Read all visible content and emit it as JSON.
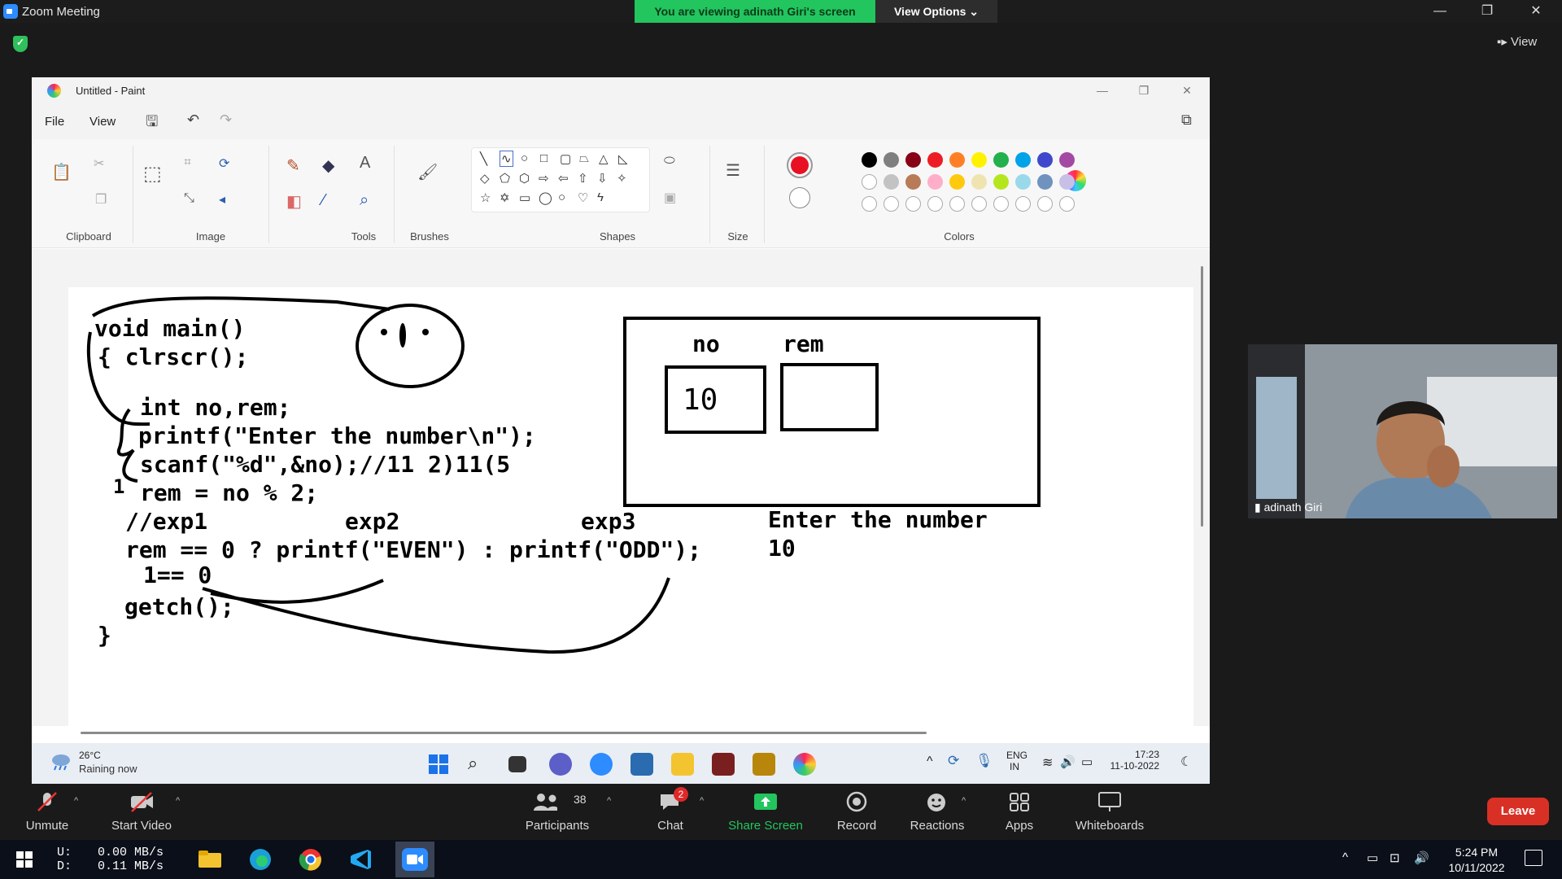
{
  "zoom": {
    "window_title": "Zoom Meeting",
    "banner": "You are viewing adinath Giri's screen",
    "view_options": "View Options ⌄",
    "view_label": "View",
    "controls": {
      "unmute": "Unmute",
      "start_video": "Start Video",
      "participants": "Participants",
      "participants_count": "38",
      "chat": "Chat",
      "chat_badge": "2",
      "share_screen": "Share Screen",
      "record": "Record",
      "reactions": "Reactions",
      "apps": "Apps",
      "whiteboards": "Whiteboards",
      "leave": "Leave"
    },
    "participant_name": "adinath Giri",
    "colors": {
      "share_green": "#23c55e",
      "leave_red": "#d93025"
    }
  },
  "paint": {
    "title": "Untitled - Paint",
    "menu": {
      "file": "File",
      "view": "View"
    },
    "groups": {
      "clipboard": "Clipboard",
      "image": "Image",
      "tools": "Tools",
      "brushes": "Brushes",
      "shapes": "Shapes",
      "size": "Size",
      "colors": "Colors"
    },
    "primary_color": "#e81123",
    "palette_row1": [
      "#000000",
      "#7f7f7f",
      "#880015",
      "#ed1c24",
      "#ff7f27",
      "#fff200",
      "#22b14c",
      "#00a2e8",
      "#3f48cc",
      "#a349a4"
    ],
    "palette_row2": [
      "#ffffff",
      "#c3c3c3",
      "#b97a57",
      "#ffaec9",
      "#ffc90e",
      "#efe4b0",
      "#b5e61d",
      "#99d9ea",
      "#7092be",
      "#c8bfe7"
    ]
  },
  "drawing": {
    "code_lines": [
      "void main()",
      "{ clrscr();",
      "int no,rem;",
      "printf(\"Enter the number\\n\");",
      "scanf(\"%d\",&no);//11 2)11(5",
      "rem = no % 2;",
      "//exp1",
      "exp2",
      "exp3",
      "rem == 0 ? printf(\"EVEN\") : printf(\"ODD\");",
      "1== 0",
      "getch();",
      "}",
      "1"
    ],
    "memory": {
      "var1_label": "no",
      "var2_label": "rem",
      "var1_value": "10",
      "var2_value": ""
    },
    "output_lines": [
      "Enter the number",
      "10"
    ]
  },
  "inner_taskbar": {
    "weather_temp": "26°C",
    "weather_desc": "Raining now",
    "lang1": "ENG",
    "lang2": "IN",
    "time": "17:23",
    "date": "11-10-2022"
  },
  "host_taskbar": {
    "net_labels": "U:\nD:",
    "net_up": "0.00 MB/s",
    "net_down": "0.11 MB/s",
    "time": "5:24 PM",
    "date": "10/11/2022"
  }
}
